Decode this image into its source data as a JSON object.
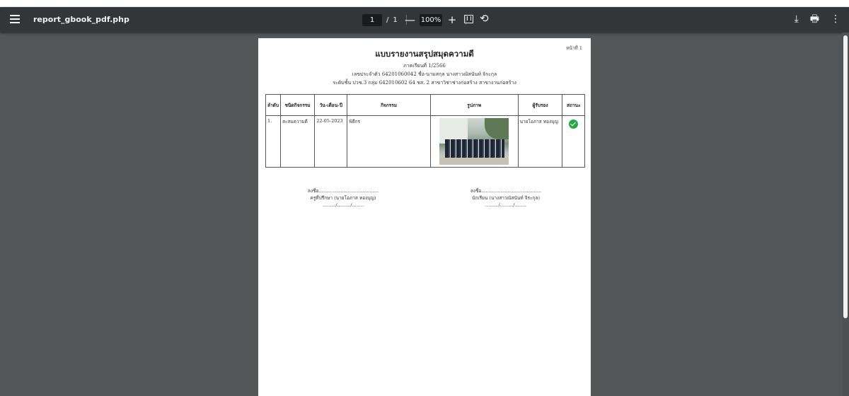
{
  "toolbar": {
    "title": "report_gbook_pdf.php",
    "current_page": "1",
    "page_separator": "/",
    "total_pages": "1",
    "zoom_minus": "—",
    "zoom": "100%",
    "zoom_plus": "+",
    "rotate_glyph": "⟲",
    "download_glyph": "⤓",
    "print_glyph": "🖶",
    "more_glyph": "⋮"
  },
  "document": {
    "page_label": "หน้าที่ 1",
    "title": "แบบรายงานสรุปสมุดความดี",
    "semester": "ภาคเรียนที่ 1/2566",
    "student_line": "เลขประจำตัว 64201060042   ชื่อ-นามสกุล นางสาวณัสนันท์ จิระกุล",
    "class_line": "ระดับชั้น ปวช.3 กลุ่ม 642010602 64 ชส. 2 สาขาวิชาช่างก่อสร้าง สาขางานก่อสร้าง",
    "table": {
      "headers": [
        "ลำดับ",
        "ชนิดกิจกรรม",
        "วัน-เดือน-ปี",
        "กิจกรรม",
        "รูปภาพ",
        "ผู้รับรอง",
        "สถานะ"
      ],
      "rows": [
        {
          "no": "1.",
          "type": "สะสมความดี",
          "date": "22-05-2023",
          "activity": "พิธีกร",
          "certifier": "นายโอภาส ทองบุญ",
          "status": "approved"
        }
      ]
    },
    "signatures": {
      "left": {
        "sign_line": "ลงชื่อ.........................................",
        "name": "ครูที่ปรึกษา (นายโอภาส ทองบุญ)",
        "date_line": "........./........./........"
      },
      "right": {
        "sign_line": "ลงชื่อ.........................................",
        "name": "นักเรียน (นางสาวณัสนันท์ จิระกุล)",
        "date_line": "........./........./........"
      }
    }
  },
  "colors": {
    "viewer_bg": "#525659",
    "toolbar_bg": "#323639",
    "status_approved": "#28a745"
  }
}
